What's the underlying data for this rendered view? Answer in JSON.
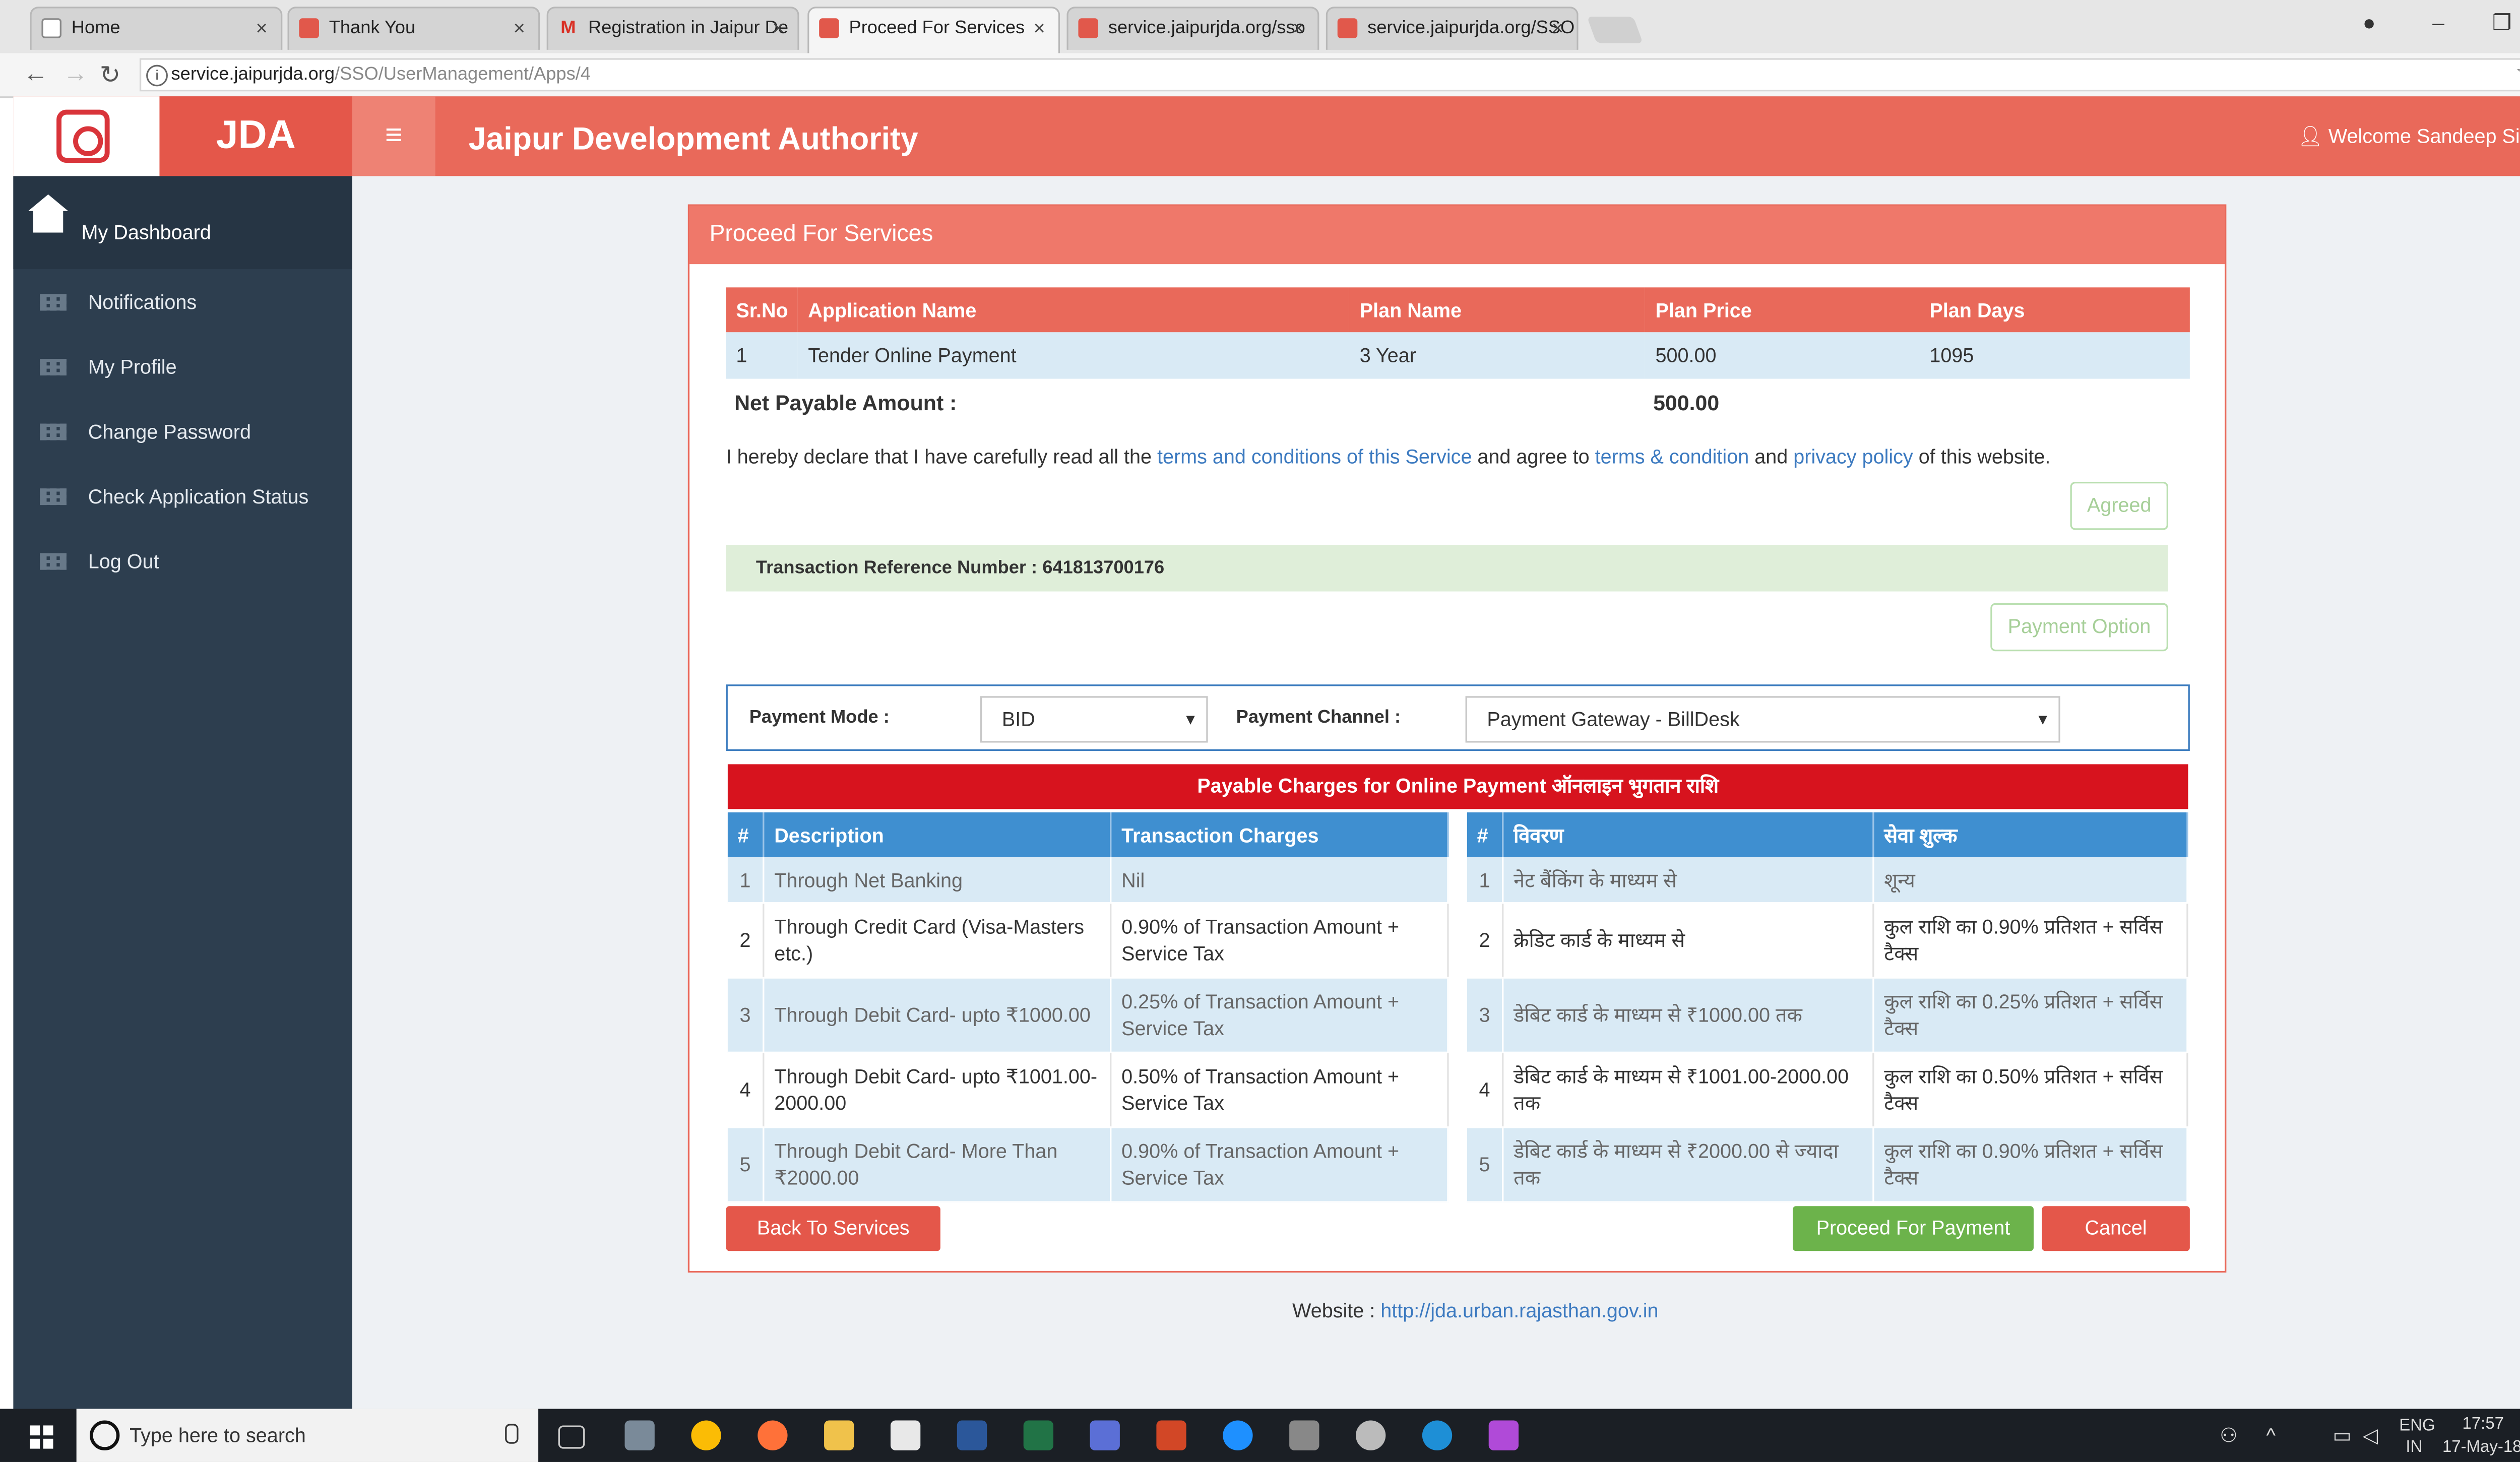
{
  "browser": {
    "tabs": [
      {
        "title": "Home",
        "icon": "page-icon"
      },
      {
        "title": "Thank You",
        "icon": "jda-favicon"
      },
      {
        "title": "Registration in Jaipur De",
        "icon": "gmail-icon"
      },
      {
        "title": "Proceed For Services",
        "icon": "jda-favicon"
      },
      {
        "title": "service.jaipurjda.org/sso",
        "icon": "jda-favicon"
      },
      {
        "title": "service.jaipurjda.org/SSO",
        "icon": "jda-favicon"
      }
    ],
    "url_host": "service.jaipurjda.org",
    "url_path": "/SSO/UserManagement/Apps/4"
  },
  "header": {
    "logo_text": "JDA",
    "title": "Jaipur Development Authority",
    "welcome": "Welcome Sandeep Singh"
  },
  "sidebar": {
    "dashboard": "My Dashboard",
    "items": [
      {
        "label": "Notifications"
      },
      {
        "label": "My Profile"
      },
      {
        "label": "Change Password"
      },
      {
        "label": "Check Application Status"
      },
      {
        "label": "Log Out"
      }
    ]
  },
  "panel": {
    "title": "Proceed For Services",
    "app_table": {
      "headers": [
        "Sr.No",
        "Application Name",
        "Plan Name",
        "Plan Price",
        "Plan Days"
      ],
      "rows": [
        [
          "1",
          "Tender Online Payment",
          "3 Year",
          "500.00",
          "1095"
        ]
      ]
    },
    "net_payable_label": "Net Payable Amount :",
    "net_payable_value": "500.00",
    "declaration": {
      "t1": "I hereby declare that I have carefully read all the ",
      "l1": "terms and conditions of this Service",
      "t2": " and agree to ",
      "l2": "terms & condition",
      "t3": " and ",
      "l3": "privacy policy",
      "t4": " of this website."
    },
    "agreed_button": "Agreed",
    "transaction_ref": "Transaction Reference Number : 641813700176",
    "payment_option_button": "Payment Option",
    "payment_mode_label": "Payment Mode :",
    "payment_mode_value": "BID",
    "payment_channel_label": "Payment Channel :",
    "payment_channel_value": "Payment Gateway - BillDesk",
    "charges_title": "Payable Charges for Online Payment ऑनलाइन भुगतान राशि",
    "charges_en": {
      "headers": [
        "#",
        "Description",
        "Transaction Charges"
      ],
      "rows": [
        [
          "1",
          "Through Net Banking",
          "Nil"
        ],
        [
          "2",
          "Through Credit Card (Visa-Masters etc.)",
          "0.90% of Transaction Amount + Service Tax"
        ],
        [
          "3",
          "Through Debit Card- upto ₹1000.00",
          "0.25% of Transaction Amount + Service Tax"
        ],
        [
          "4",
          "Through Debit Card- upto ₹1001.00-2000.00",
          "0.50% of Transaction Amount + Service Tax"
        ],
        [
          "5",
          "Through Debit Card- More Than ₹2000.00",
          "0.90% of Transaction Amount + Service Tax"
        ]
      ]
    },
    "charges_hi": {
      "headers": [
        "#",
        "विवरण",
        "सेवा शुल्क"
      ],
      "rows": [
        [
          "1",
          "नेट बैंकिंग के माध्यम से",
          "शून्य"
        ],
        [
          "2",
          "क्रेडिट कार्ड के माध्यम से",
          "कुल राशि का 0.90% प्रतिशत + सर्विस टैक्स"
        ],
        [
          "3",
          "डेबिट कार्ड के माध्यम से ₹1000.00 तक",
          "कुल राशि का 0.25% प्रतिशत + सर्विस टैक्स"
        ],
        [
          "4",
          "डेबिट कार्ड के माध्यम से ₹1001.00-2000.00 तक",
          "कुल राशि का 0.50% प्रतिशत + सर्विस टैक्स"
        ],
        [
          "5",
          "डेबिट कार्ड के माध्यम से ₹2000.00 से ज्यादा तक",
          "कुल राशि का 0.90% प्रतिशत + सर्विस टैक्स"
        ]
      ]
    },
    "back_button": "Back To Services",
    "proceed_button": "Proceed For Payment",
    "cancel_button": "Cancel"
  },
  "footer": {
    "label": "Website : ",
    "link": "http://jda.urban.rajasthan.gov.in"
  },
  "taskbar": {
    "search_placeholder": "Type here to search",
    "lang": "ENG",
    "region": "IN",
    "time": "17:57",
    "date": "17-May-18"
  },
  "colors": {
    "brand": "#e9695a",
    "sidebar": "#2d3e4f",
    "table_header_blue": "#3f8fd0",
    "charges_red": "#d7131e",
    "proceed_green": "#6cb34b",
    "cancel_red": "#e4574a"
  }
}
